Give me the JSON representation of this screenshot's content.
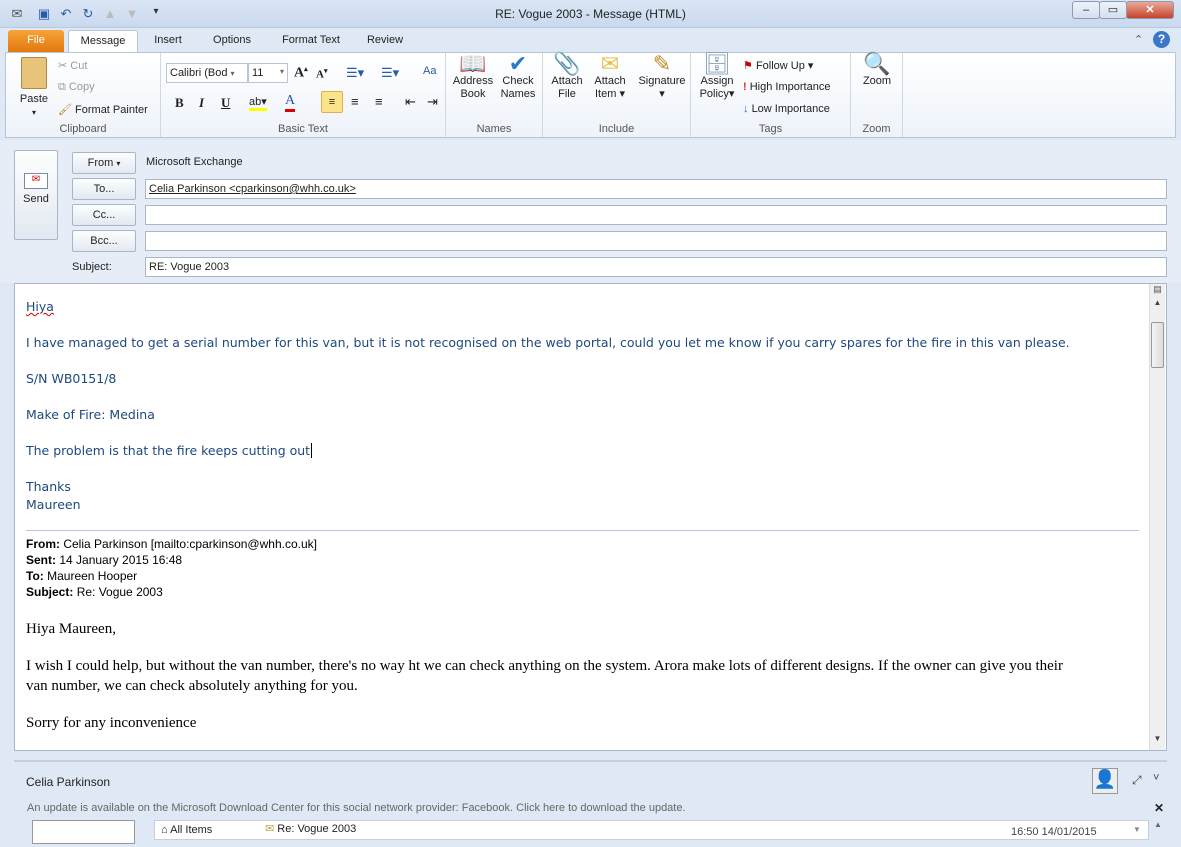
{
  "window": {
    "title": "RE: Vogue 2003 - Message (HTML)"
  },
  "tabs": [
    "File",
    "Message",
    "Insert",
    "Options",
    "Format Text",
    "Review"
  ],
  "ribbon": {
    "clipboard": {
      "label": "Clipboard",
      "paste": "Paste",
      "cut": "Cut",
      "copy": "Copy",
      "format_painter": "Format Painter"
    },
    "basic_text": {
      "label": "Basic Text",
      "font": "Calibri (Body)",
      "font_display": "Calibri (Bod",
      "size": "11",
      "bold": "B",
      "italic": "I",
      "underline": "U"
    },
    "names": {
      "label": "Names",
      "address_book": [
        "Address",
        "Book"
      ],
      "check_names": [
        "Check",
        "Names"
      ]
    },
    "include": {
      "label": "Include",
      "attach_file": [
        "Attach",
        "File"
      ],
      "attach_item": [
        "Attach",
        "Item"
      ],
      "signature": "Signature"
    },
    "tags": {
      "label": "Tags",
      "assign_policy": [
        "Assign",
        "Policy"
      ],
      "follow_up": "Follow Up",
      "high": "High Importance",
      "low": "Low Importance"
    },
    "zoom": {
      "label": "Zoom",
      "zoom": "Zoom"
    }
  },
  "header": {
    "send": "Send",
    "from_btn": "From",
    "from_value": "Microsoft Exchange",
    "to_btn": "To...",
    "to_value": "Celia Parkinson <cparkinson@whh.co.uk>",
    "cc_btn": "Cc...",
    "bcc_btn": "Bcc...",
    "subject_label": "Subject:",
    "subject_value": "RE: Vogue 2003"
  },
  "body": {
    "lines": [
      "Hiya",
      "I have managed to get a serial number for this van, but it is not recognised on the web portal, could you let me know if you carry spares for the fire in this van please.",
      "S/N  WB0151/8",
      "Make of Fire:  Medina",
      "The problem is that the fire keeps cutting out",
      "Thanks",
      "Maureen"
    ],
    "quoted": {
      "from_label": "From:",
      "from": "Celia Parkinson [mailto:cparkinson@whh.co.uk]",
      "sent_label": "Sent:",
      "sent": "14 January 2015 16:48",
      "to_label": "To:",
      "to": "Maureen Hooper",
      "subject_label": "Subject:",
      "subject": "Re: Vogue 2003"
    },
    "quoted_lines": [
      "Hiya Maureen,",
      "I wish I could help, but without the van number, there's no way ht we can check anything on the system. Arora make lots of different designs. If the owner can give you their",
      "van number, we can check absolutely anything for you.",
      "Sorry for any inconvenience"
    ]
  },
  "people_pane": {
    "name": "Celia Parkinson",
    "update_notice": "An update is available on the Microsoft Download Center for this social network provider: Facebook. Click here to download the update.",
    "all_items": "All Items",
    "item_subject": "Re: Vogue 2003",
    "item_time": "16:50 14/01/2015"
  }
}
